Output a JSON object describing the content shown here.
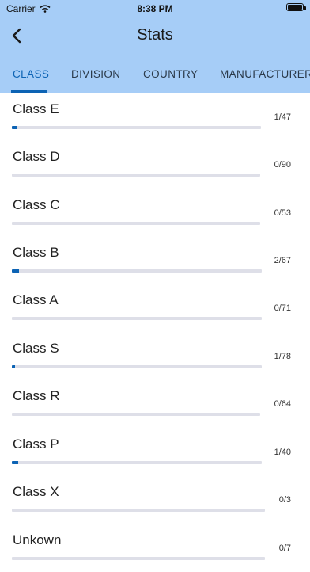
{
  "status": {
    "carrier": "Carrier",
    "time": "8:38 PM"
  },
  "nav": {
    "title": "Stats",
    "back_icon": "chevron-left-icon"
  },
  "tabs": [
    {
      "label": "CLASS",
      "active": true
    },
    {
      "label": "DIVISION",
      "active": false
    },
    {
      "label": "COUNTRY",
      "active": false
    },
    {
      "label": "MANUFACTURER",
      "active": false
    }
  ],
  "colors": {
    "header": "#a6cdf7",
    "accent": "#0c63b4",
    "track": "#dedfe8"
  },
  "rows": [
    {
      "label": "Class E",
      "count": "1/47",
      "done": 1,
      "total": 47
    },
    {
      "label": "Class D",
      "count": "0/90",
      "done": 0,
      "total": 90
    },
    {
      "label": "Class C",
      "count": "0/53",
      "done": 0,
      "total": 53
    },
    {
      "label": "Class B",
      "count": "2/67",
      "done": 2,
      "total": 67
    },
    {
      "label": "Class A",
      "count": "0/71",
      "done": 0,
      "total": 71
    },
    {
      "label": "Class S",
      "count": "1/78",
      "done": 1,
      "total": 78
    },
    {
      "label": "Class R",
      "count": "0/64",
      "done": 0,
      "total": 64
    },
    {
      "label": "Class P",
      "count": "1/40",
      "done": 1,
      "total": 40
    },
    {
      "label": "Class X",
      "count": "0/3",
      "done": 0,
      "total": 3
    },
    {
      "label": "Unkown",
      "count": "0/7",
      "done": 0,
      "total": 7
    }
  ]
}
